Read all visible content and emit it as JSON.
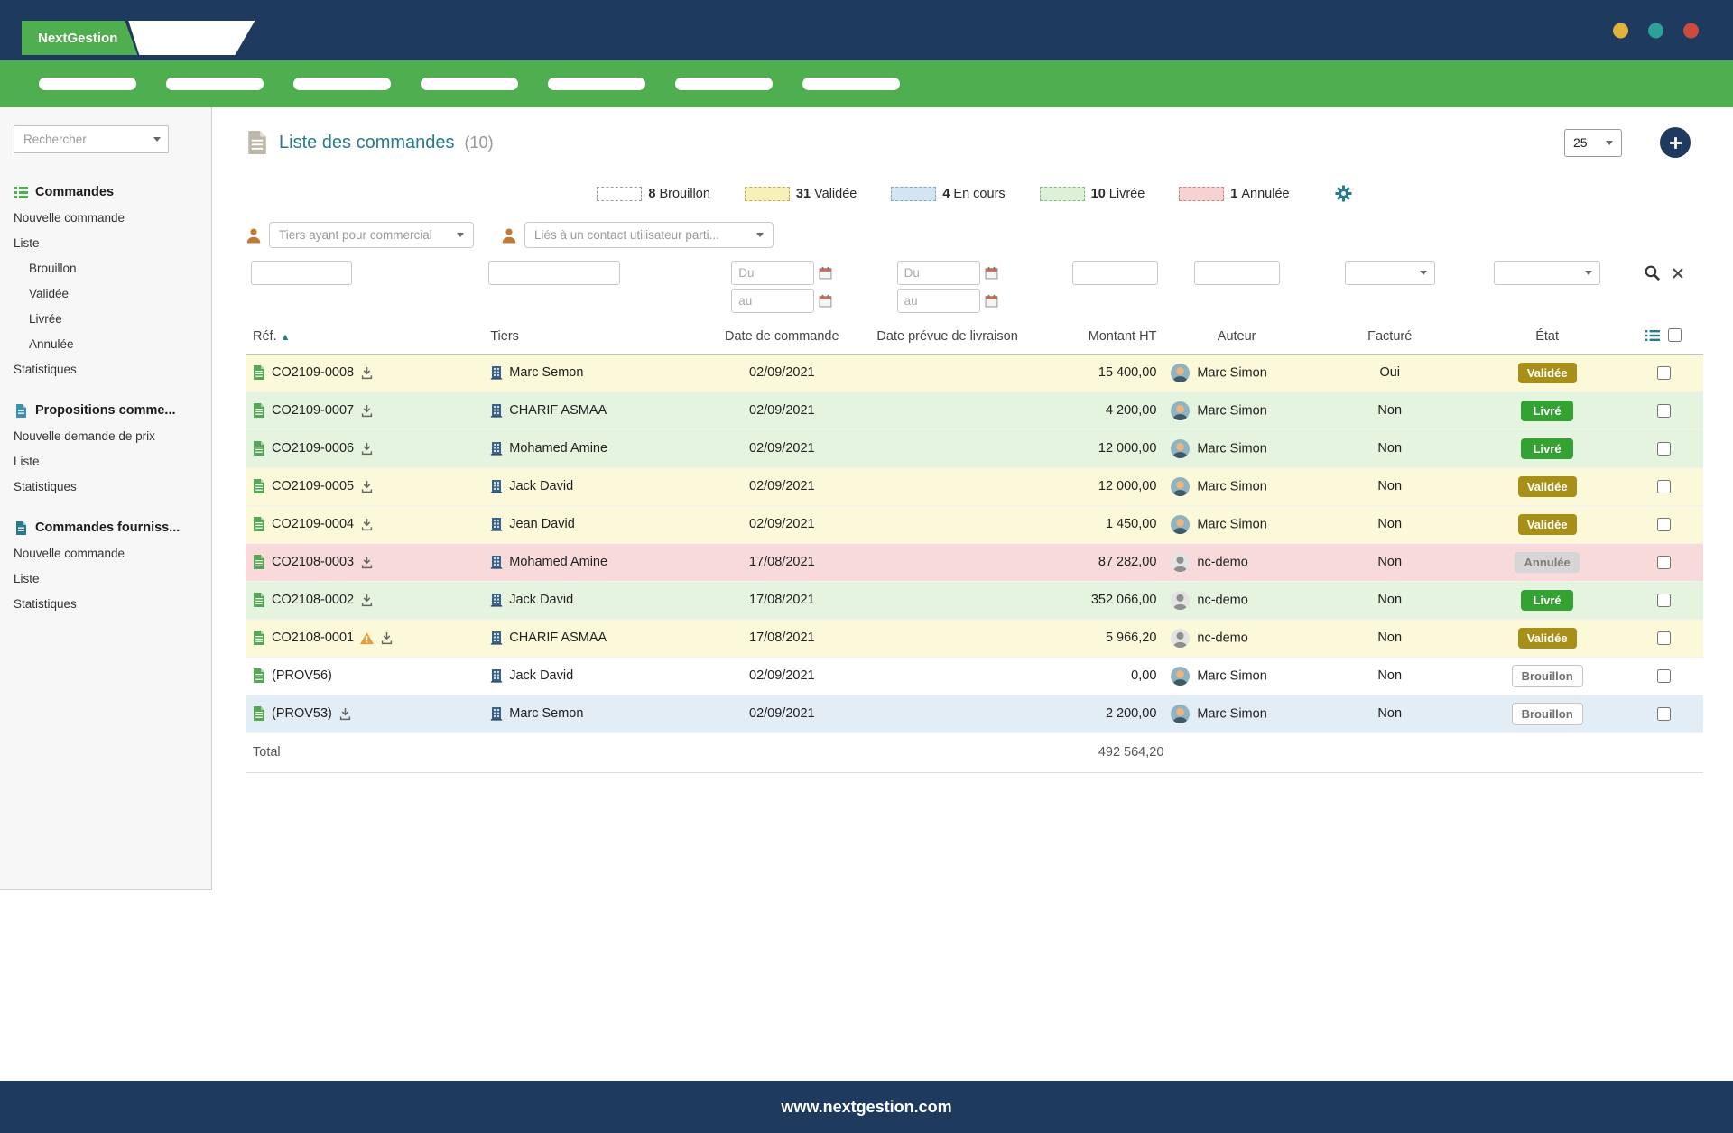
{
  "topbar": {
    "brand": "NextGestion"
  },
  "menubar": {
    "pills": [
      "",
      "",
      "",
      "",
      "",
      "",
      ""
    ]
  },
  "sidebar": {
    "search_placeholder": "Rechercher",
    "sections": {
      "commandes": {
        "title": "Commandes",
        "items": [
          {
            "label": "Nouvelle commande",
            "level": "lvl0"
          },
          {
            "label": "Liste",
            "level": "lvl0"
          },
          {
            "label": "Brouillon",
            "level": "lvl1"
          },
          {
            "label": "Validée",
            "level": "lvl1"
          },
          {
            "label": "Livrée",
            "level": "lvl1"
          },
          {
            "label": "Annulée",
            "level": "lvl1"
          },
          {
            "label": "Statistiques",
            "level": "lvl0"
          }
        ]
      },
      "propositions": {
        "title": "Propositions comme...",
        "items": [
          {
            "label": "Nouvelle demande de prix",
            "level": "lvl0"
          },
          {
            "label": "Liste",
            "level": "lvl0"
          },
          {
            "label": "Statistiques",
            "level": "lvl0"
          }
        ]
      },
      "fournisseurs": {
        "title": "Commandes fourniss...",
        "items": [
          {
            "label": "Nouvelle commande",
            "level": "lvl0"
          },
          {
            "label": "Liste",
            "level": "lvl0"
          },
          {
            "label": "Statistiques",
            "level": "lvl0"
          }
        ]
      }
    }
  },
  "page": {
    "title": "Liste des commandes",
    "count": "(10)",
    "page_size": "25"
  },
  "legend": {
    "items": [
      {
        "count": "8",
        "label": "Brouillon",
        "key": "brouillon"
      },
      {
        "count": "31",
        "label": "Validée",
        "key": "validee"
      },
      {
        "count": "4",
        "label": "En cours",
        "key": "encours"
      },
      {
        "count": "10",
        "label": "Livrée",
        "key": "livree"
      },
      {
        "count": "1",
        "label": "Annulée",
        "key": "annulee"
      }
    ]
  },
  "filters": {
    "commercial": "Tiers ayant pour commercial",
    "contact": "Liés à un contact utilisateur parti...",
    "date_from": "Du",
    "date_to": "au"
  },
  "table": {
    "columns": [
      {
        "label": "Réf.",
        "sort_icon": "▲",
        "align": "al"
      },
      {
        "label": "Tiers",
        "align": "al"
      },
      {
        "label": "Date de commande",
        "align": "ac"
      },
      {
        "label": "Date prévue de livraison",
        "align": "ac"
      },
      {
        "label": "Montant HT",
        "align": "ar"
      },
      {
        "label": "Auteur",
        "align": "ac"
      },
      {
        "label": "Facturé",
        "align": "ac"
      },
      {
        "label": "État",
        "align": "ac"
      },
      {
        "label": "",
        "align": "ac",
        "is_sel": true
      }
    ],
    "rows": [
      {
        "ref": "CO2109-0008",
        "has_warning": false,
        "has_download": true,
        "tiers": "Marc Semon",
        "date": "02/09/2021",
        "delivery": "",
        "amount": "15 400,00",
        "author": "Marc Simon",
        "avatar": "photo",
        "billed": "Oui",
        "status": "Validée",
        "status_key": "validee",
        "row_key": "bg-validee"
      },
      {
        "ref": "CO2109-0007",
        "has_warning": false,
        "has_download": true,
        "tiers": "CHARIF ASMAA",
        "date": "02/09/2021",
        "delivery": "",
        "amount": "4 200,00",
        "author": "Marc Simon",
        "avatar": "photo",
        "billed": "Non",
        "status": "Livré",
        "status_key": "livree",
        "row_key": "bg-livree"
      },
      {
        "ref": "CO2109-0006",
        "has_warning": false,
        "has_download": true,
        "tiers": "Mohamed Amine",
        "date": "02/09/2021",
        "delivery": "",
        "amount": "12 000,00",
        "author": "Marc Simon",
        "avatar": "photo",
        "billed": "Non",
        "status": "Livré",
        "status_key": "livree",
        "row_key": "bg-livree"
      },
      {
        "ref": "CO2109-0005",
        "has_warning": false,
        "has_download": true,
        "tiers": "Jack David",
        "date": "02/09/2021",
        "delivery": "",
        "amount": "12 000,00",
        "author": "Marc Simon",
        "avatar": "photo",
        "billed": "Non",
        "status": "Validée",
        "status_key": "validee",
        "row_key": "bg-validee"
      },
      {
        "ref": "CO2109-0004",
        "has_warning": false,
        "has_download": true,
        "tiers": "Jean David",
        "date": "02/09/2021",
        "delivery": "",
        "amount": "1 450,00",
        "author": "Marc Simon",
        "avatar": "photo",
        "billed": "Non",
        "status": "Validée",
        "status_key": "validee",
        "row_key": "bg-validee"
      },
      {
        "ref": "CO2108-0003",
        "has_warning": false,
        "has_download": true,
        "tiers": "Mohamed Amine",
        "date": "17/08/2021",
        "delivery": "",
        "amount": "87 282,00",
        "author": "nc-demo",
        "avatar": "generic",
        "billed": "Non",
        "status": "Annulée",
        "status_key": "annulee",
        "row_key": "bg-annulee"
      },
      {
        "ref": "CO2108-0002",
        "has_warning": false,
        "has_download": true,
        "tiers": "Jack David",
        "date": "17/08/2021",
        "delivery": "",
        "amount": "352 066,00",
        "author": "nc-demo",
        "avatar": "generic",
        "billed": "Non",
        "status": "Livré",
        "status_key": "livree",
        "row_key": "bg-livree"
      },
      {
        "ref": "CO2108-0001",
        "has_warning": true,
        "has_download": true,
        "tiers": "CHARIF ASMAA",
        "date": "17/08/2021",
        "delivery": "",
        "amount": "5 966,20",
        "author": "nc-demo",
        "avatar": "generic",
        "billed": "Non",
        "status": "Validée",
        "status_key": "validee",
        "row_key": "bg-validee"
      },
      {
        "ref": "(PROV56)",
        "has_warning": false,
        "has_download": false,
        "tiers": "Jack David",
        "date": "02/09/2021",
        "delivery": "",
        "amount": "0,00",
        "author": "Marc Simon",
        "avatar": "photo",
        "billed": "Non",
        "status": "Brouillon",
        "status_key": "brouillon",
        "row_key": "bg-plain"
      },
      {
        "ref": "(PROV53)",
        "has_warning": false,
        "has_download": true,
        "tiers": "Marc Semon",
        "date": "02/09/2021",
        "delivery": "",
        "amount": "2 200,00",
        "author": "Marc Simon",
        "avatar": "photo",
        "billed": "Non",
        "status": "Brouillon",
        "status_key": "brouillon",
        "row_key": "bg-stripe"
      }
    ],
    "total_label": "Total",
    "total_amount": "492 564,20"
  },
  "footer": {
    "url": "www.nextgestion.com"
  },
  "colors": {
    "navy": "#1e3a5f",
    "green": "#4fae4f",
    "teal_link": "#2b7a8c",
    "badge_validee": "#a88f18",
    "badge_livre": "#34a233",
    "badge_annulee_bg": "#d6d6d6",
    "row_validee": "#fbf9da",
    "row_livree": "#e4f4de",
    "row_annulee": "#f9dada",
    "row_draft_stripe": "#e2edf6",
    "dot_yellow": "#e2b33c",
    "dot_teal": "#2ba198",
    "dot_red": "#cd4b3d"
  }
}
